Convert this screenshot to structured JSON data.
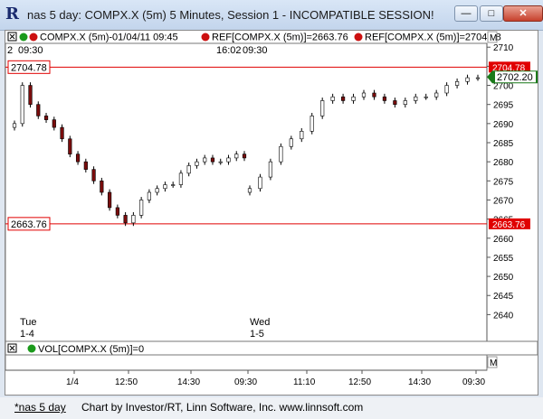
{
  "window": {
    "title": "nas 5 day: COMPX.X (5m) 5 Minutes, Session 1 - INCOMPATIBLE SESSION!",
    "minimize": "—",
    "restore": "□",
    "close": "✕"
  },
  "legend": {
    "symbol": "COMPX.X (5m)-01/04/11 09:45",
    "ref_low": "REF[COMPX.X (5m)]=2663.76",
    "ref_high": "REF[COMPX.X (5m)]=2704.78",
    "max_marker": "M",
    "top_left": "2",
    "time_1": "09:30",
    "time_2": "16:02",
    "time_3": "09:30"
  },
  "volume_panel": {
    "label": "VOL[COMPX.X (5m)]=0",
    "marker": "M"
  },
  "footer": {
    "tab": "*nas 5 day",
    "credits": "Chart by Investor/RT, Linn Software, Inc. www.linnsoft.com"
  },
  "chart_data": {
    "type": "candlestick",
    "title": "nas 5 day: COMPX.X (5m)",
    "ylim": [
      2633,
      2711
    ],
    "y_ticks": [
      2640,
      2645,
      2650,
      2655,
      2660,
      2665,
      2670,
      2675,
      2680,
      2685,
      2690,
      2695,
      2700,
      2705,
      2710
    ],
    "x_ticks": [
      "1/4",
      "12:50",
      "14:30",
      "09:30",
      "11:10",
      "12:50",
      "14:30",
      "09:30"
    ],
    "day_labels": [
      {
        "day": "Tue",
        "date": "1-4"
      },
      {
        "day": "Wed",
        "date": "1-5"
      }
    ],
    "reference_lines": [
      {
        "label": "2704.78",
        "value": 2704.78,
        "color": "#e00000"
      },
      {
        "label": "2663.76",
        "value": 2663.76,
        "color": "#e00000"
      }
    ],
    "last_price": {
      "label": "2702.20",
      "value": 2702.2,
      "color": "#1a7a1a"
    },
    "day1_close": [
      2690,
      2700,
      2695,
      2692,
      2691,
      2689,
      2686,
      2682,
      2680,
      2678,
      2675,
      2672,
      2668,
      2666,
      2664,
      2666,
      2670,
      2672,
      2673,
      2674,
      2674,
      2677,
      2679,
      2680,
      2681,
      2680,
      2680,
      2681,
      2682,
      2681
    ],
    "day2_close": [
      2673,
      2676,
      2680,
      2684,
      2686,
      2688,
      2692,
      2696,
      2697,
      2696,
      2697,
      2698,
      2697,
      2696,
      2695,
      2696,
      2697,
      2697,
      2698,
      2700,
      2701,
      2702,
      2702
    ]
  }
}
